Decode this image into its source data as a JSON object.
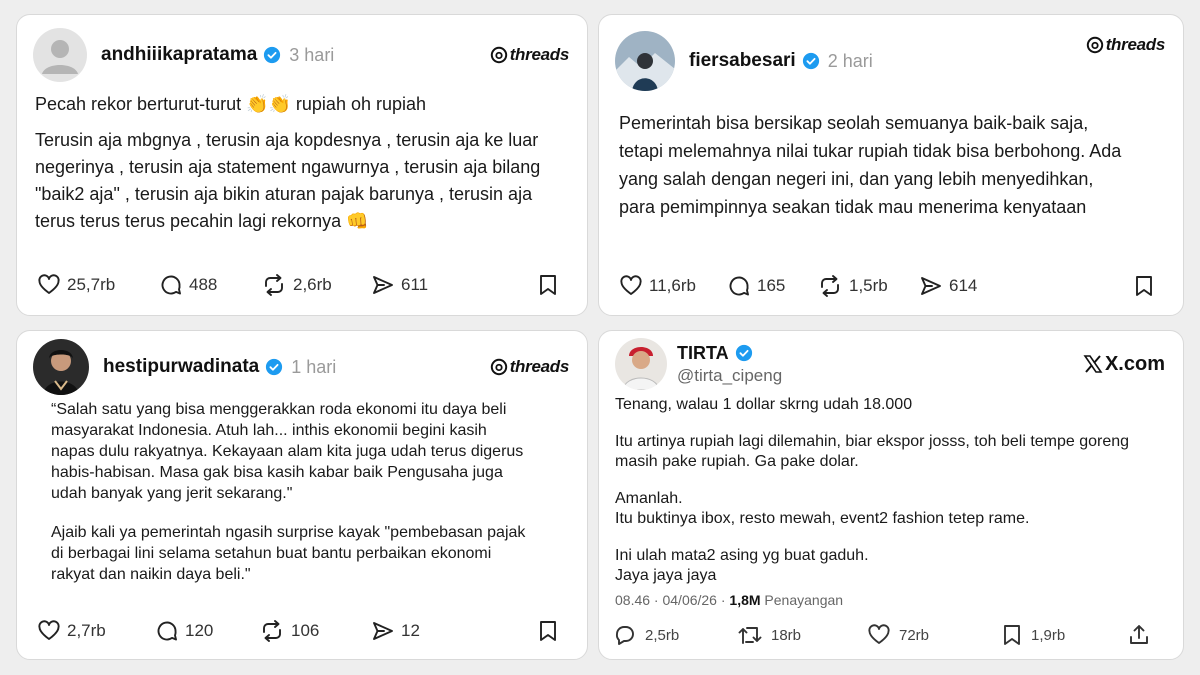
{
  "posts": [
    {
      "username": "andhiiikapratama",
      "time": "3 hari",
      "platform": "threads",
      "paragraphs": [
        "Pecah rekor berturut-turut 👏👏 rupiah oh rupiah",
        "Terusin aja mbgnya , terusin aja kopdesnya , terusin aja ke luar negerinya , terusin aja statement ngawurnya , terusin aja bilang \"baik2 aja\" , terusin aja bikin aturan pajak barunya , terusin aja terus terus terus pecahin lagi rekornya 👊"
      ],
      "likes": "25,7rb",
      "replies": "488",
      "reposts": "2,6rb",
      "shares": "611"
    },
    {
      "username": "fiersabesari",
      "time": "2 hari",
      "platform": "threads",
      "paragraphs": [
        "Pemerintah bisa bersikap seolah semuanya baik-baik saja, tetapi melemahnya nilai tukar rupiah tidak bisa berbohong. Ada yang salah dengan negeri ini, dan yang lebih menyedihkan, para pemimpinnya seakan tidak mau menerima kenyataan"
      ],
      "likes": "11,6rb",
      "replies": "165",
      "reposts": "1,5rb",
      "shares": "614"
    },
    {
      "username": "hestipurwadinata",
      "time": "1 hari",
      "platform": "threads",
      "paragraphs": [
        "“Salah satu yang bisa menggerakkan roda ekonomi itu daya beli masyarakat Indonesia. Atuh lah... inthis ekonomii begini kasih napas dulu rakyatnya. Kekayaan alam kita juga udah terus digerus habis-habisan. Masa gak bisa kasih kabar baik  Pengusaha juga udah banyak yang jerit sekarang.\"",
        "Ajaib kali ya pemerintah ngasih surprise kayak \"pembebasan pajak di berbagai lini selama setahun buat bantu perbaikan ekonomi rakyat dan naikin daya beli.\""
      ],
      "likes": "2,7rb",
      "replies": "120",
      "reposts": "106",
      "shares": "12"
    }
  ],
  "x_post": {
    "name": "TIRTA",
    "handle": "@tirta_cipeng",
    "platform": "X.com",
    "paragraphs": [
      "Tenang, walau 1 dollar skrng udah 18.000",
      "Itu artinya rupiah lagi dilemahin, biar ekspor josss, toh beli tempe goreng masih pake rupiah. Ga pake dolar.",
      "Amanlah.\nItu buktinya ibox, resto mewah, event2 fashion tetep rame.",
      "Ini ulah mata2 asing yg buat gaduh.\nJaya jaya jaya"
    ],
    "meta_time": "08.46 · 04/06/26 · ",
    "views": "1,8M",
    "views_label": " Penayangan",
    "replies": "2,5rb",
    "reposts": "18rb",
    "likes": "72rb",
    "bookmarks": "1,9rb"
  },
  "colors": {
    "verified": "#1d9bf0",
    "border": "#d9d9d9",
    "muted": "#9a9a9a",
    "background": "#eeeeee"
  }
}
